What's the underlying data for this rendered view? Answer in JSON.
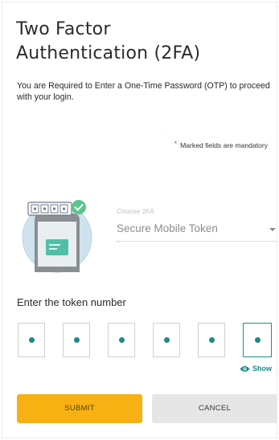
{
  "header": {
    "title_line1": "Two Factor",
    "title_line2": "Authentication (2FA)"
  },
  "intro": {
    "text": "You are Required to Enter a One-Time Password (OTP) to proceed with your login."
  },
  "mandatory_note": {
    "star": "*",
    "text": "Marked fields are mandatory"
  },
  "method": {
    "label": "Choose 2FA",
    "selected": "Secure Mobile Token"
  },
  "token": {
    "label": "Enter the token number",
    "box_count": 6,
    "filled_count": 6,
    "active_index": 5
  },
  "show_toggle": {
    "label": "Show"
  },
  "actions": {
    "submit": "SUBMIT",
    "cancel": "CANCEL"
  },
  "colors": {
    "accent_teal": "#1a8c84",
    "submit_bg": "#f7b112",
    "cancel_bg": "#e6e6e6"
  },
  "icons": {
    "illustration": "mobile-token-illustration",
    "check": "check-icon",
    "eye": "eye-icon",
    "caret": "chevron-down-icon"
  }
}
